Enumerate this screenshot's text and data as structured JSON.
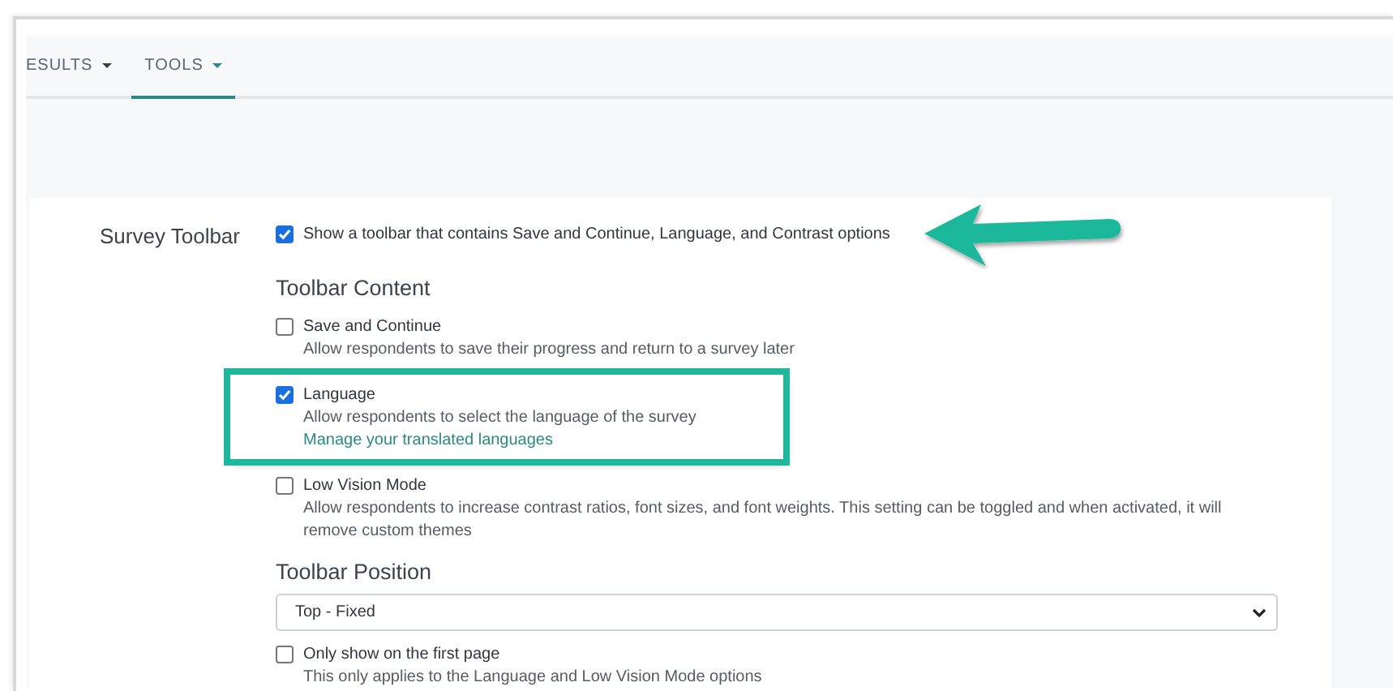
{
  "nav": {
    "tabs": [
      {
        "label": "ESULTS",
        "selected": false
      },
      {
        "label": "TOOLS",
        "selected": true
      }
    ]
  },
  "setting": {
    "label": "Survey Toolbar",
    "master": {
      "label": "Show a toolbar that contains Save and Continue, Language, and Contrast options",
      "checked": true,
      "annotated": true
    },
    "content_heading": "Toolbar Content",
    "options": [
      {
        "label": "Save and Continue",
        "checked": false,
        "highlighted": false,
        "description": "Allow respondents to save their progress and return to a survey later"
      },
      {
        "label": "Language",
        "checked": true,
        "highlighted": true,
        "description": "Allow respondents to select the language of the survey",
        "link": "Manage your translated languages"
      },
      {
        "label": "Low Vision Mode",
        "checked": false,
        "highlighted": false,
        "description": "Allow respondents to increase contrast ratios, font sizes, and font weights. This setting can be toggled and when activated, it will remove custom themes"
      }
    ],
    "position_heading": "Toolbar Position",
    "position": {
      "value": "Top - Fixed"
    },
    "first_page": {
      "label": "Only show on the first page",
      "checked": false,
      "description": "This only applies to the Language and Low Vision Mode options"
    }
  }
}
